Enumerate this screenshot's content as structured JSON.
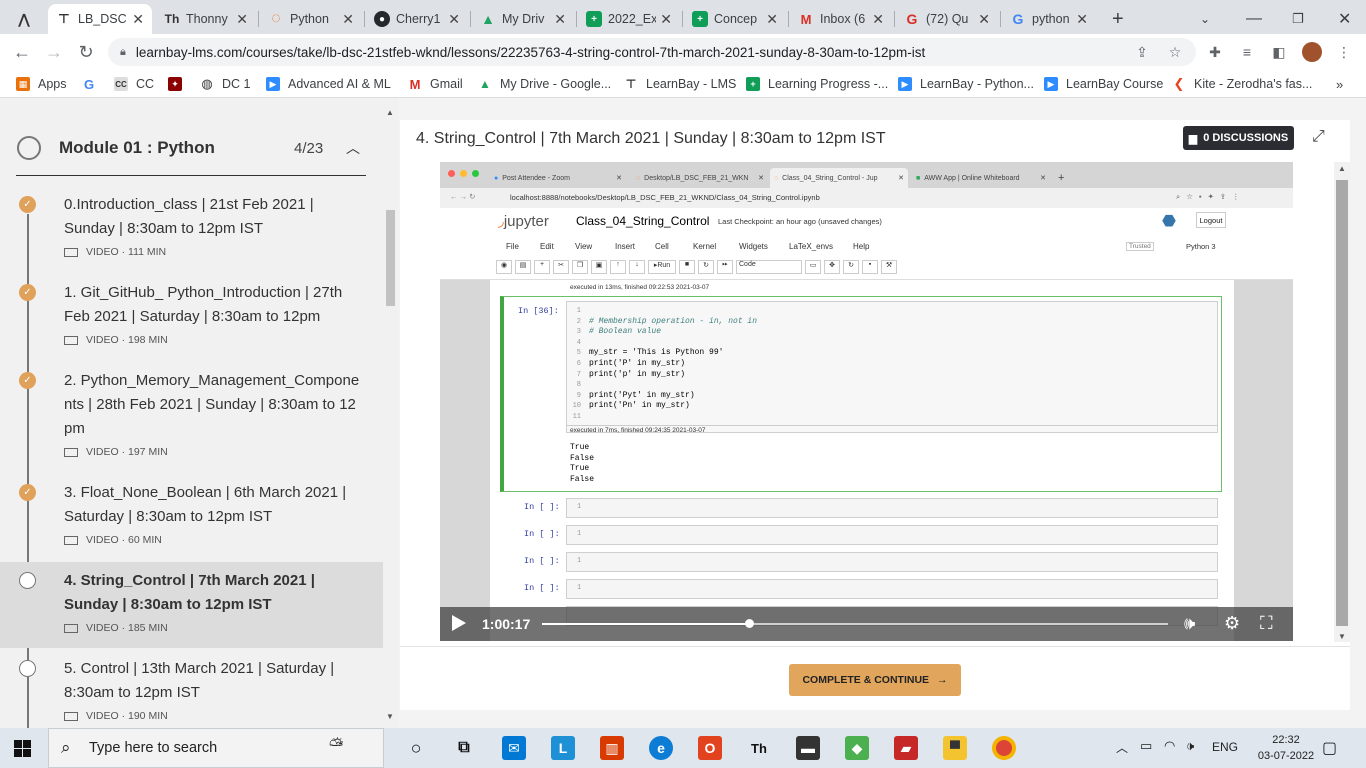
{
  "browser": {
    "tabs": [
      {
        "label": "LB_DSC",
        "icon": "learnbay-logo-icon",
        "active": false
      },
      {
        "label": "LB_DSC",
        "icon": "learnbay-lms-icon",
        "active": true
      },
      {
        "label": "Thonny",
        "icon": "thonny-icon",
        "active": false
      },
      {
        "label": "Python",
        "icon": "jupyter-icon",
        "active": false
      },
      {
        "label": "Cherry1",
        "icon": "github-icon",
        "active": false
      },
      {
        "label": "My Driv",
        "icon": "google-drive-icon",
        "active": false
      },
      {
        "label": "2022_Ex",
        "icon": "google-sheets-icon",
        "active": false
      },
      {
        "label": "Concep",
        "icon": "google-sheets-icon",
        "active": false
      },
      {
        "label": "Inbox (6",
        "icon": "gmail-icon",
        "active": false
      },
      {
        "label": "(72) Qu",
        "icon": "quora-icon",
        "active": false
      },
      {
        "label": "python",
        "icon": "google-icon",
        "active": false
      }
    ],
    "url": "learnbay-lms.com/courses/take/lb-dsc-21stfeb-wknd/lessons/22235763-4-string-control-7th-march-2021-sunday-8-30am-to-12pm-ist",
    "bookmarks": [
      "Apps",
      "CC",
      "DC 1",
      "Advanced AI & ML",
      "Gmail",
      "My Drive - Google...",
      "LearnBay - LMS",
      "Learning Progress -...",
      "LearnBay - Python...",
      "LearnBay Course",
      "Kite - Zerodha's fas..."
    ]
  },
  "sidebar": {
    "module_title": "Module 01 : Python",
    "module_progress": "4/23",
    "lessons": [
      {
        "title": "0.Introduction_class | 21st Feb 2021 | Sunday | 8:30am to 12pm IST",
        "meta": "VIDEO · 111 MIN",
        "completed": true
      },
      {
        "title": "1. Git_GitHub_ Python_Introduction | 27th Feb 2021 | Saturday | 8:30am to 12pm",
        "meta": "VIDEO · 198 MIN",
        "completed": true
      },
      {
        "title": "2. Python_Memory_Management_Components | 28th Feb 2021 | Sunday | 8:30am to 12pm",
        "meta": "VIDEO · 197 MIN",
        "completed": true
      },
      {
        "title": "3. Float_None_Boolean | 6th March 2021 | Saturday | 8:30am to 12pm IST",
        "meta": "VIDEO · 60 MIN",
        "completed": true
      },
      {
        "title": "4. String_Control | 7th March 2021 | Sunday | 8:30am to 12pm IST",
        "meta": "VIDEO · 185 MIN",
        "completed": false,
        "active": true
      },
      {
        "title": "5. Control | 13th March 2021 | Saturday | 8:30am to 12pm IST",
        "meta": "VIDEO · 190 MIN",
        "completed": false
      }
    ]
  },
  "content": {
    "lesson_title": "4. String_Control | 7th March 2021 | Sunday | 8:30am to 12pm IST",
    "discussions": "0 DISCUSSIONS",
    "complete_button": "COMPLETE & CONTINUE",
    "video": {
      "timecode": "1:00:17",
      "progress": 0.33,
      "inner_tabs": [
        "Post Attendee - Zoom",
        "Desktop/LB_DSC_FEB_21_WKN",
        "Class_04_String_Control - Jup",
        "AWW App | Online Whiteboard"
      ],
      "inner_url": "localhost:8888/notebooks/Desktop/LB_DSC_FEB_21_WKND/Class_04_String_Control.ipynb",
      "notebook_name": "Class_04_String_Control",
      "checkpoint": "Last Checkpoint: an hour ago  (unsaved changes)",
      "logout": "Logout",
      "menu": [
        "File",
        "Edit",
        "View",
        "Insert",
        "Cell",
        "Kernel",
        "Widgets",
        "LaTeX_envs",
        "Help"
      ],
      "trusted": "Trusted",
      "kernel": "Python 3",
      "cell_type": "Code",
      "prev_exec": "executed in 13ms, finished 09:22:53 2021-03-07",
      "prompt": "In [36]:",
      "code_lines": [
        "# Membership operation - in, not in",
        "# Boolean value",
        "",
        "my_str = 'This is Python 99'",
        "print('P' in my_str)",
        "print('p' in my_str)",
        "",
        "print('Pyt' in my_str)",
        "print('Pn' in my_str)",
        "",
        ""
      ],
      "exec_info": "executed in 7ms, finished 09:24:35 2021-03-07",
      "output": [
        "True",
        "False",
        "True",
        "False"
      ],
      "empty_prompt": "In [ ]:",
      "jupyter_label": "jupyter",
      "run_label": "Run"
    }
  },
  "taskbar": {
    "search_placeholder": "Type here to search",
    "language": "ENG",
    "time": "22:32",
    "date": "03-07-2022"
  }
}
